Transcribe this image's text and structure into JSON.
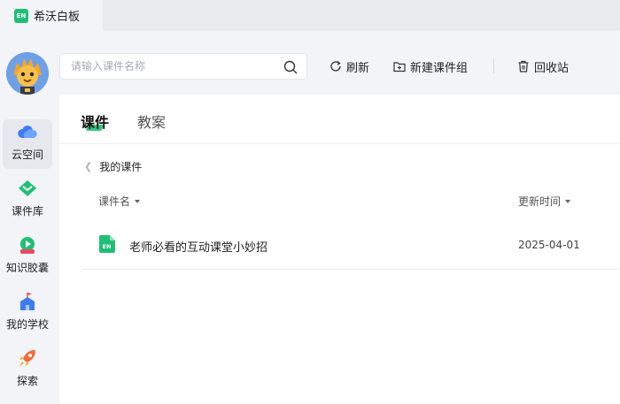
{
  "app": {
    "logo_text": "EN",
    "title": "希沃白板"
  },
  "nav": {
    "items": [
      {
        "label": "云空间",
        "icon": "cloud-icon",
        "active": true
      },
      {
        "label": "课件库",
        "icon": "courseware-library-icon",
        "active": false
      },
      {
        "label": "知识胶囊",
        "icon": "knowledge-capsule-icon",
        "active": false
      },
      {
        "label": "我的学校",
        "icon": "school-icon",
        "active": false
      },
      {
        "label": "探索",
        "icon": "rocket-icon",
        "active": false
      }
    ]
  },
  "toolbar": {
    "search_placeholder": "请输入课件名称",
    "search_value": "",
    "refresh_label": "刷新",
    "new_group_label": "新建课件组",
    "recycle_label": "回收站"
  },
  "tabs": [
    {
      "label": "课件",
      "active": true
    },
    {
      "label": "教案",
      "active": false
    }
  ],
  "breadcrumb": {
    "label": "我的课件"
  },
  "table": {
    "columns": {
      "name": "课件名",
      "updated": "更新时间"
    },
    "rows": [
      {
        "icon_text": "EN",
        "name": "老师必看的互动课堂小妙招",
        "updated": "2025-04-01"
      }
    ]
  },
  "colors": {
    "accent": "#1fbf75",
    "background": "#f3f4f7"
  }
}
